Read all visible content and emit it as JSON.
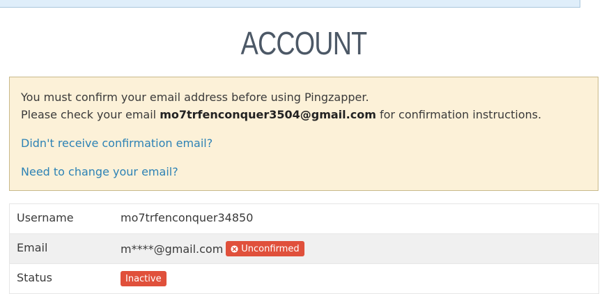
{
  "page": {
    "title": "ACCOUNT"
  },
  "alert": {
    "line1": "You must confirm your email address before using Pingzapper.",
    "line2_prefix": "Please check your email ",
    "line2_email": "mo7trfenconquer3504@gmail.com",
    "line2_suffix": " for confirmation instructions.",
    "resend_link": "Didn't receive confirmation email?",
    "change_email_link": "Need to change your email?"
  },
  "account": {
    "rows": [
      {
        "label": "Username",
        "value": "mo7trfenconquer34850"
      },
      {
        "label": "Email",
        "value": "m****@gmail.com",
        "badge": "Unconfirmed",
        "badge_icon": "x-circle-icon"
      },
      {
        "label": "Status",
        "badge": "Inactive"
      }
    ]
  },
  "colors": {
    "badge_red": "#e0503b",
    "link_blue": "#2d82b5",
    "alert_bg": "#fcf1d8"
  }
}
